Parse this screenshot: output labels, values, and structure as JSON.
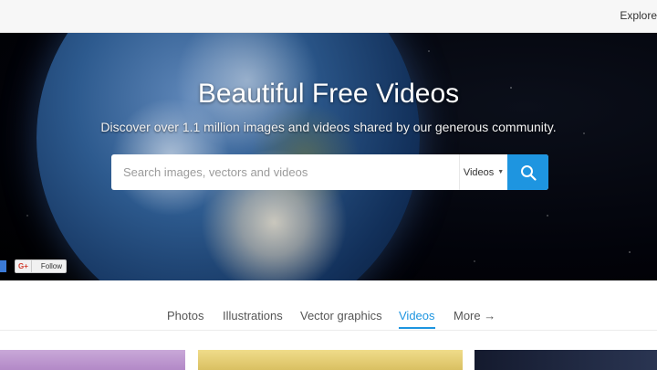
{
  "topbar": {
    "explore": "Explore"
  },
  "hero": {
    "title": "Beautiful Free Videos",
    "subtitle": "Discover over 1.1 million images and videos shared by our generous community."
  },
  "search": {
    "placeholder": "Search images, vectors and videos",
    "type_selected": "Videos",
    "button_icon": "search-icon"
  },
  "social": {
    "google_plus": "G+",
    "follow": "Follow"
  },
  "tabs": [
    {
      "label": "Photos"
    },
    {
      "label": "Illustrations"
    },
    {
      "label": "Vector graphics"
    },
    {
      "label": "Videos",
      "active": true
    },
    {
      "label": "More →"
    }
  ],
  "colors": {
    "accent": "#1e95e0",
    "topbar": "#f7f7f7"
  }
}
